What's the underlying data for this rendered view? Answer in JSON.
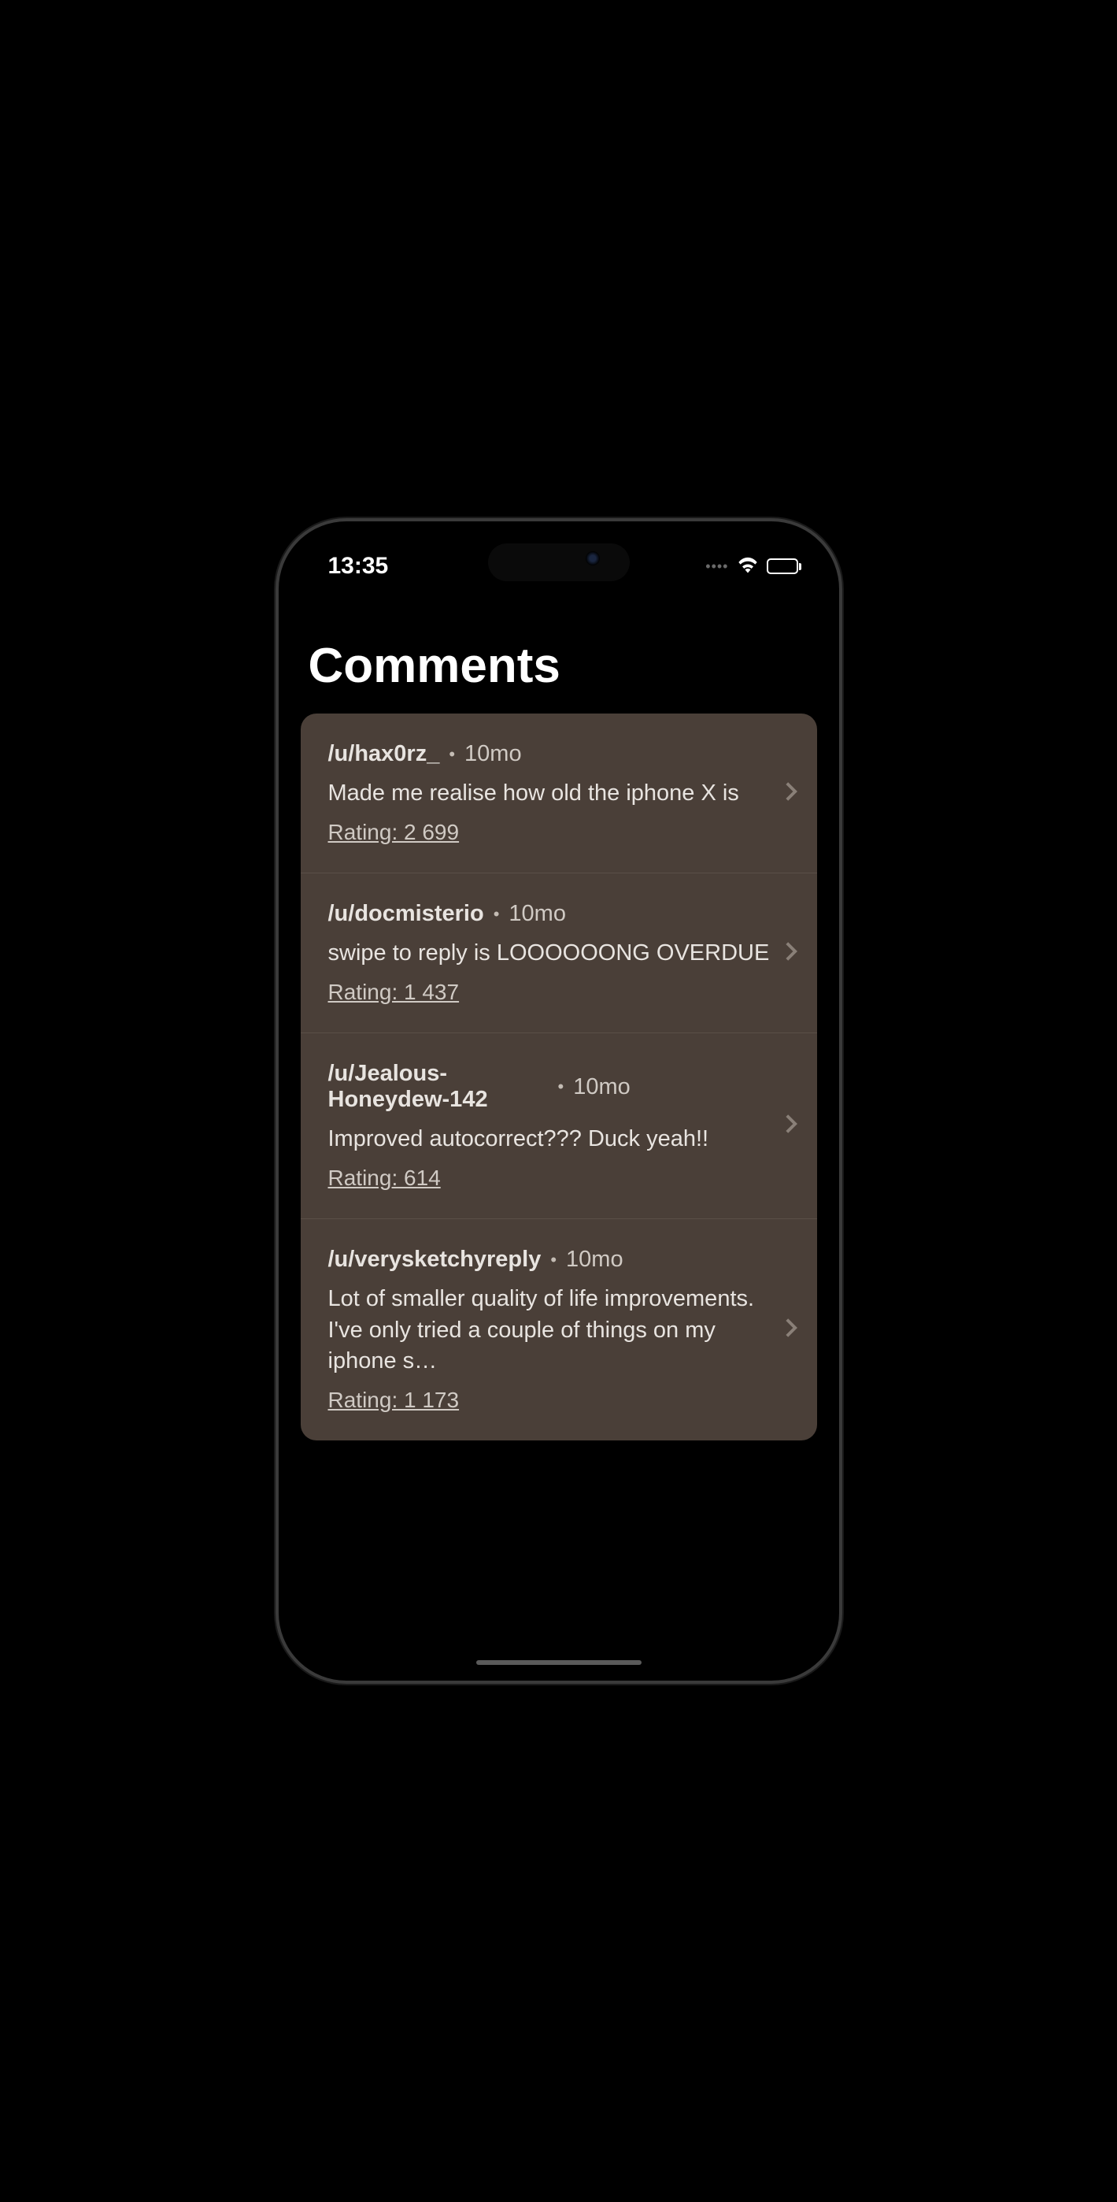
{
  "status": {
    "time": "13:35",
    "dots": "••••"
  },
  "page": {
    "title": "Comments",
    "rating_prefix": "Rating: "
  },
  "comments": [
    {
      "user": "/u/hax0rz_",
      "time": "10mo",
      "text": "Made me realise how old the iphone X is",
      "rating": "2 699"
    },
    {
      "user": "/u/docmisterio",
      "time": "10mo",
      "text": "swipe to reply is LOOOOOONG OVERDUE",
      "rating": "1 437"
    },
    {
      "user": "/u/Jealous-Honeydew-142",
      "time": "10mo",
      "text": "Improved autocorrect??? Duck yeah!!",
      "rating": "614"
    },
    {
      "user": "/u/verysketchyreply",
      "time": "10mo",
      "text": "Lot of smaller quality of life improvements. I've only tried a couple of things on my iphone s…",
      "rating": "1 173"
    }
  ]
}
